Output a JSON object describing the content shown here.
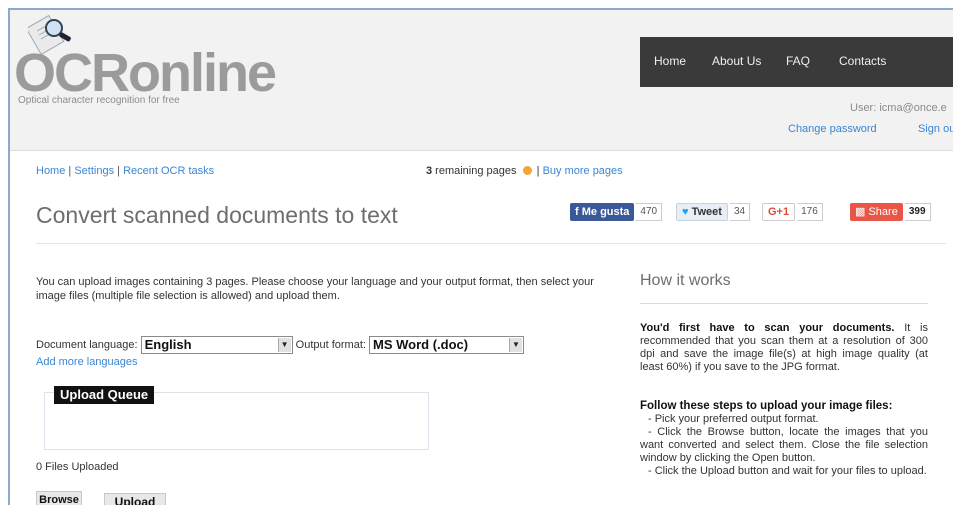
{
  "brand": {
    "name": "OCRonline",
    "tagline": "Optical character recognition for free"
  },
  "topnav": {
    "items": [
      "Home",
      "About Us",
      "FAQ",
      "Contacts"
    ]
  },
  "account": {
    "user_line": "User: icma@once.e",
    "change_password": "Change password",
    "sign_out": "Sign ou"
  },
  "breadcrumb": {
    "items": [
      "Home",
      "Settings",
      "Recent OCR tasks"
    ],
    "separator": "|"
  },
  "remaining": {
    "count": "3",
    "text": " remaining pages",
    "separator": "|",
    "buy": "Buy more pages"
  },
  "page_title": "Convert scanned documents to text",
  "social": {
    "facebook": {
      "label": "Me gusta",
      "count": "470"
    },
    "twitter": {
      "label": "Tweet",
      "count": "34"
    },
    "gplus": {
      "label": "G+1",
      "count": "176"
    },
    "share": {
      "label": "Share",
      "count": "399"
    }
  },
  "intro_text": "You can upload images containing 3 pages. Please choose your language and your output format, then select your image files (multiple file selection is allowed) and upload them.",
  "form": {
    "language_label": "Document language:",
    "language_value": "English",
    "output_label": "Output format:",
    "output_value": "MS Word (.doc)",
    "add_more": "Add more languages"
  },
  "upload": {
    "queue_title": "Upload Queue",
    "files_uploaded": "0 Files Uploaded",
    "browse": "Browse",
    "upload": "Upload"
  },
  "how_it_works": {
    "title": "How it works",
    "p1_bold": "You'd first have to scan your documents.",
    "p1_rest": " It is recommended that you scan them at a resolution of 300 dpi and save the image file(s) at high image quality (at least 60%) if you save to the JPG format.",
    "p2_bold": "Follow these steps to upload your image files:",
    "steps": [
      "- Pick your preferred output format.",
      "- Click the Browse button, locate the images that you want converted and select them. Close the file selection window by clicking the Open button.",
      "- Click the Upload button and wait for your files to upload."
    ]
  },
  "colors": {
    "link": "#3a86d4",
    "nav_bg": "#3a3a3a",
    "facebook": "#3b5998",
    "share": "#e95547"
  }
}
